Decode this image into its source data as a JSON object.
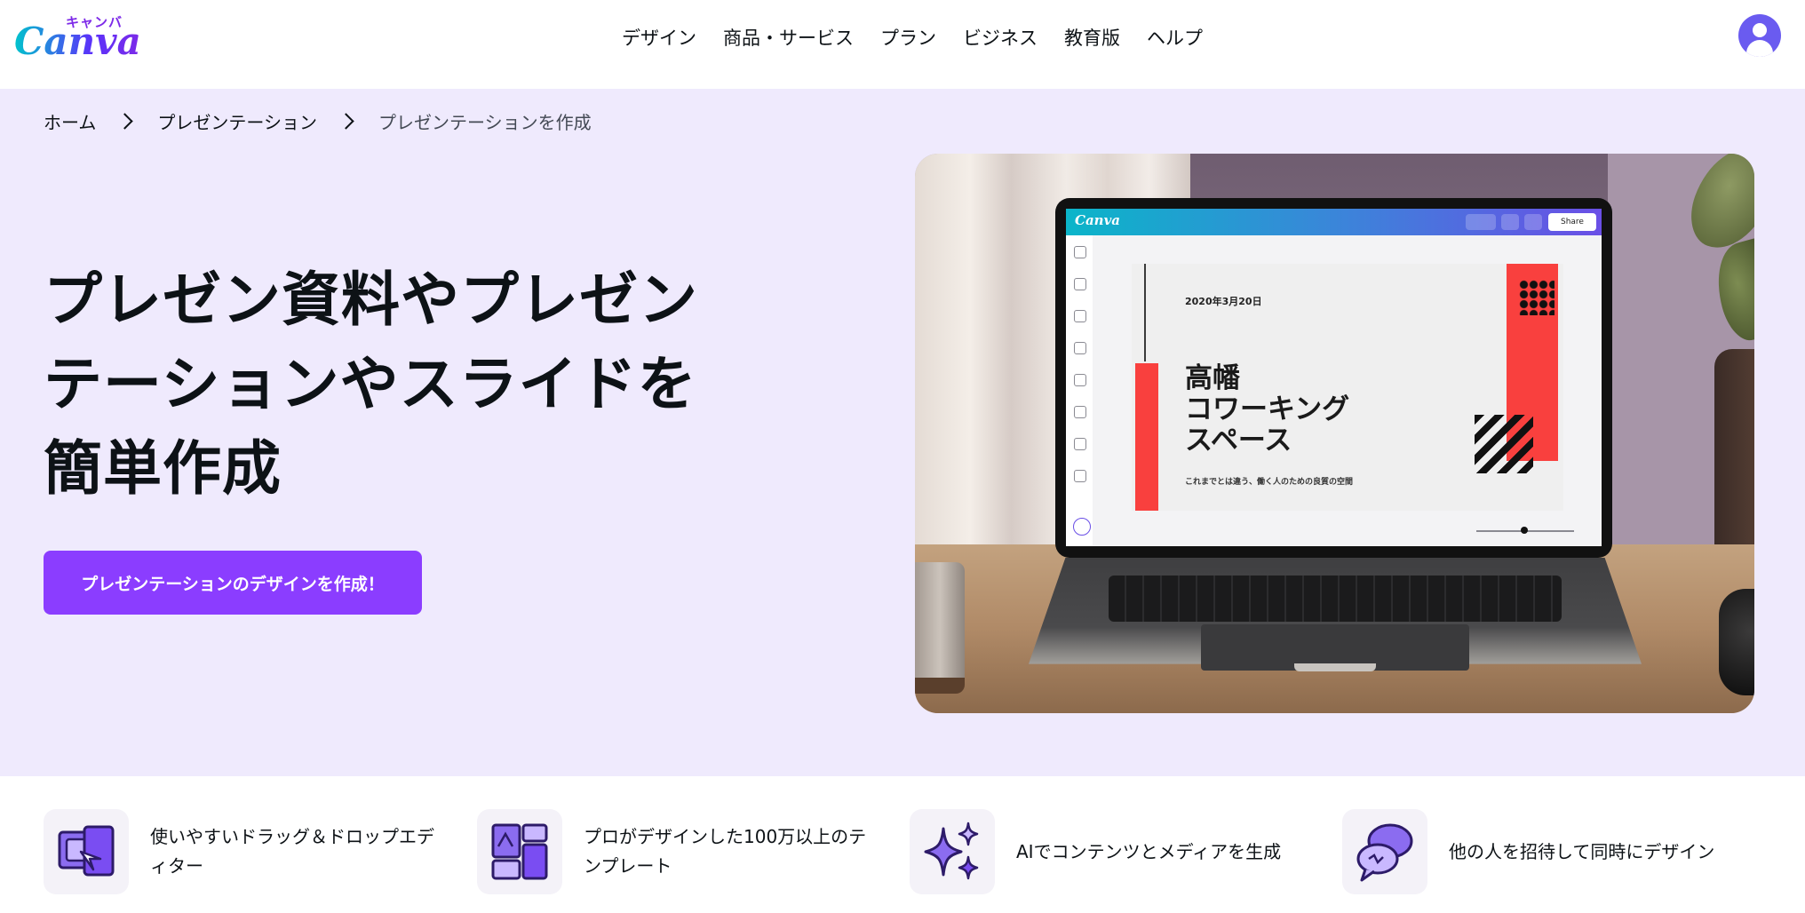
{
  "header": {
    "logo_kana": "キャンバ",
    "logo_text": "Canva",
    "nav": [
      "デザイン",
      "商品・サービス",
      "プラン",
      "ビジネス",
      "教育版",
      "ヘルプ"
    ]
  },
  "breadcrumb": [
    "ホーム",
    "プレゼンテーション",
    "プレゼンテーションを作成"
  ],
  "hero": {
    "title": "プレゼン資料やプレゼンテーションやスライドを簡単作成",
    "cta": "プレゼンテーションのデザインを作成！"
  },
  "mockup": {
    "app_logo": "Canva",
    "share_label": "Share",
    "slide_date": "2020年3月20日",
    "slide_title": "高幡\nコワーキング\nスペース",
    "slide_subtitle": "これまでとは違う、働く人のための良質の空間"
  },
  "features": [
    {
      "text": "使いやすいドラッグ＆ドロップエディター",
      "icon": "drag-drop-editor-icon"
    },
    {
      "text": "プロがデザインした100万以上のテンプレート",
      "icon": "templates-icon"
    },
    {
      "text": "AIでコンテンツとメディアを生成",
      "icon": "sparkles-icon"
    },
    {
      "text": "他の人を招待して同時にデザイン",
      "icon": "collaboration-chat-icon"
    }
  ],
  "colors": {
    "accent": "#8b3dff",
    "hero_bg": "#efeafd",
    "avatar": "#6a5bf0"
  }
}
